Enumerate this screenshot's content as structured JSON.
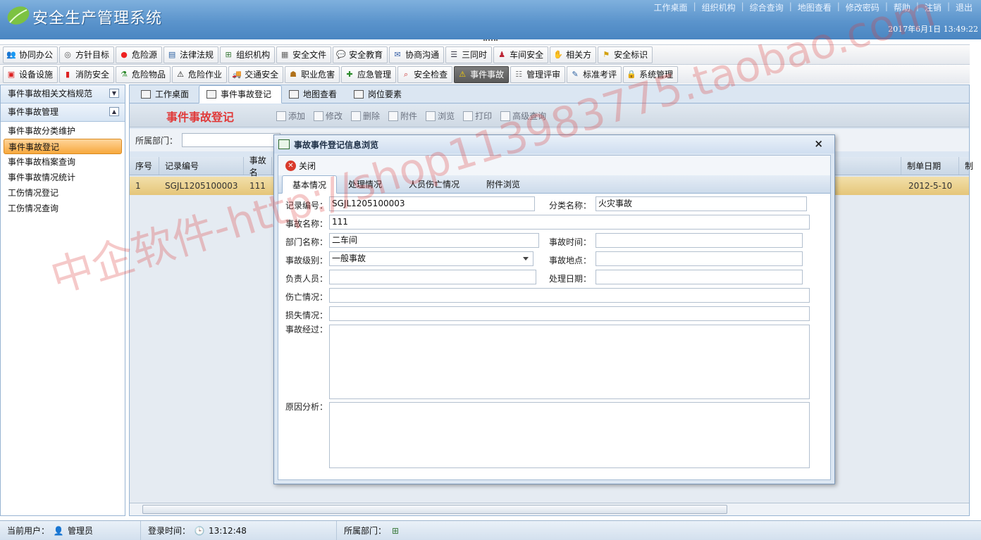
{
  "app": {
    "title": "安全生产管理系统",
    "datetime": "2017年6月1日 13:49:22"
  },
  "top_links": [
    "工作桌面",
    "组织机构",
    "综合查询",
    "地图查看",
    "修改密码",
    "帮助",
    "注销",
    "退出"
  ],
  "menu_row1": [
    {
      "label": "协同办公",
      "icon": "people-icon"
    },
    {
      "label": "方针目标",
      "icon": "target-icon"
    },
    {
      "label": "危险源",
      "icon": "red-dot-icon"
    },
    {
      "label": "法律法规",
      "icon": "book-icon"
    },
    {
      "label": "组织机构",
      "icon": "org-chart-icon"
    },
    {
      "label": "安全文件",
      "icon": "document-icon"
    },
    {
      "label": "安全教育",
      "icon": "speech-icon"
    },
    {
      "label": "协商沟通",
      "icon": "mail-icon"
    },
    {
      "label": "三同时",
      "icon": "list-icon"
    },
    {
      "label": "车间安全",
      "icon": "worker-icon"
    },
    {
      "label": "相关方",
      "icon": "handshake-icon"
    },
    {
      "label": "安全标识",
      "icon": "flag-icon"
    }
  ],
  "menu_row2": [
    {
      "label": "设备设施",
      "icon": "device-icon"
    },
    {
      "label": "消防安全",
      "icon": "extinguisher-icon"
    },
    {
      "label": "危险物品",
      "icon": "flask-icon"
    },
    {
      "label": "危险作业",
      "icon": "hazard-icon"
    },
    {
      "label": "交通安全",
      "icon": "vehicle-icon"
    },
    {
      "label": "职业危害",
      "icon": "health-icon"
    },
    {
      "label": "应急管理",
      "icon": "emergency-icon"
    },
    {
      "label": "安全检查",
      "icon": "magnifier-icon"
    },
    {
      "label": "事件事故",
      "icon": "warning-icon",
      "active": true
    },
    {
      "label": "管理评审",
      "icon": "review-icon"
    },
    {
      "label": "标准考评",
      "icon": "pencil-icon"
    },
    {
      "label": "系统管理",
      "icon": "lock-icon"
    }
  ],
  "sidebar": {
    "section1": "事件事故相关文档规范",
    "section2": "事件事故管理",
    "items": [
      "事件事故分类维护",
      "事件事故登记",
      "事件事故档案查询",
      "事件事故情况统计",
      "工伤情况登记",
      "工伤情况查询"
    ],
    "selected_index": 1
  },
  "tabs": [
    "工作桌面",
    "事件事故登记",
    "地图查看",
    "岗位要素"
  ],
  "active_tab": 1,
  "page_heading": "事件事故登记",
  "actions": [
    "添加",
    "修改",
    "删除",
    "附件",
    "浏览",
    "打印",
    "高级查询"
  ],
  "filter": {
    "label": "所属部门："
  },
  "grid": {
    "headers": [
      "序号",
      "记录编号",
      "事故名",
      "制单日期",
      "制"
    ],
    "rows": [
      [
        "1",
        "SGJL1205100003",
        "111",
        "2012-5-10"
      ]
    ]
  },
  "dialog": {
    "title": "事故事件登记信息浏览",
    "close_label": "关闭",
    "tabs": [
      "基本情况",
      "处理情况",
      "人员伤亡情况",
      "附件浏览"
    ],
    "fields": {
      "record_no_label": "记录编号：",
      "record_no": "SGJL1205100003",
      "category_label": "分类名称：",
      "category": "火灾事故",
      "accident_name_label": "事故名称：",
      "accident_name": "111",
      "department_label": "部门名称：",
      "department": "二车间",
      "accident_time_label": "事故时间：",
      "accident_time": "",
      "level_label": "事故级别：",
      "level": "一般事故",
      "location_label": "事故地点：",
      "location": "",
      "person_label": "负责人员：",
      "person": "",
      "handle_date_label": "处理日期：",
      "handle_date": "",
      "casualty_label": "伤亡情况：",
      "casualty": "",
      "loss_label": "损失情况：",
      "loss": "",
      "process_label": "事故经过：",
      "process": "",
      "cause_label": "原因分析：",
      "cause": ""
    }
  },
  "statusbar": {
    "user_label": "当前用户：",
    "user": "管理员",
    "login_label": "登录时间：",
    "login_time": "13:12:48",
    "dept_label": "所属部门："
  },
  "watermark": "中企软件-http://shop113983775.taobao.com"
}
